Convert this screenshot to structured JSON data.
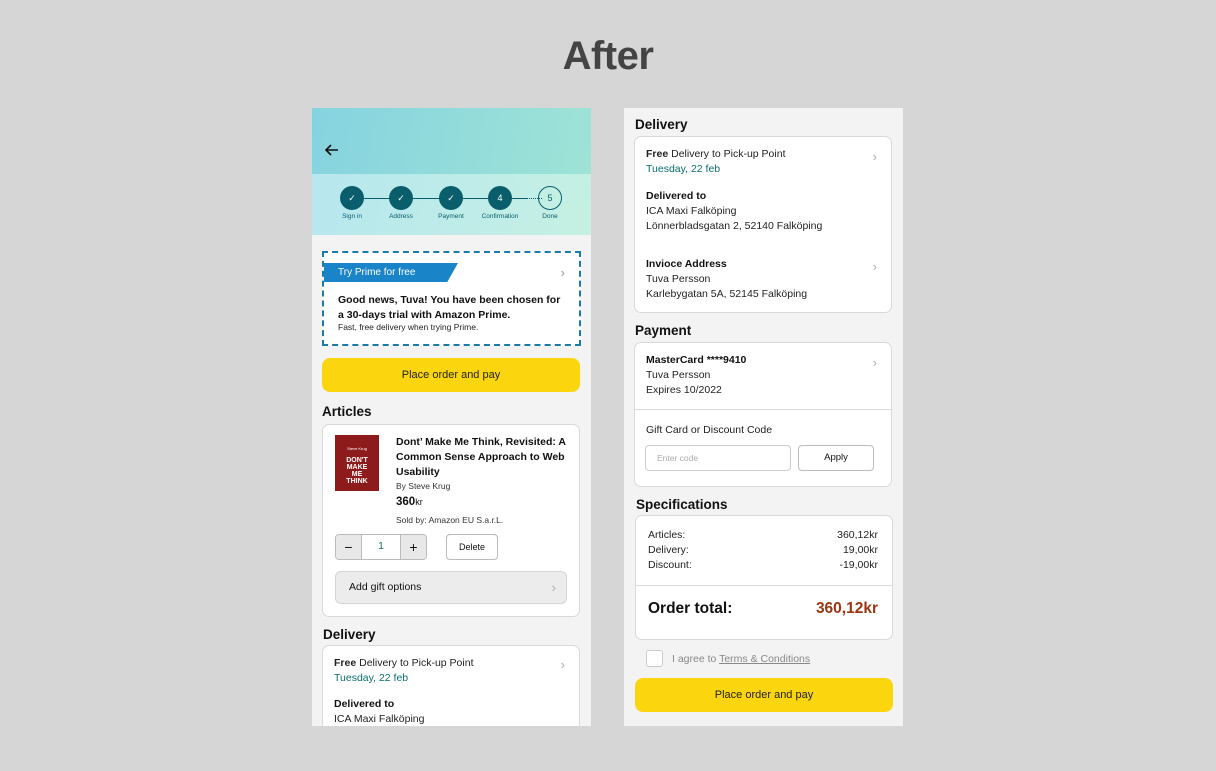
{
  "heading": "After",
  "left": {
    "steps": [
      {
        "label": "Sign in",
        "num": "✓"
      },
      {
        "label": "Address",
        "num": "✓"
      },
      {
        "label": "Payment",
        "num": "✓"
      },
      {
        "label": "Confirmation",
        "num": "4"
      },
      {
        "label": "Done",
        "num": "5"
      }
    ],
    "prime": {
      "ribbon": "Try Prime for free",
      "title": "Good news, Tuva! You have been chosen for a 30-days trial with Amazon Prime.",
      "sub": "Fast, free delivery when trying Prime."
    },
    "cta": "Place order and pay",
    "articles_title": "Articles",
    "book": {
      "cover_top": "Steve Krug",
      "cover_main": "DON'T MAKE ME THINK",
      "title": "Dont’ Make Me Think, Revisited: A Common Sense Approach to Web Usability",
      "author": "By Steve Krug",
      "price": "360",
      "currency": "kr",
      "seller": "Sold by: Amazon EU S.a.r.L."
    },
    "qty": {
      "minus": "−",
      "value": "1",
      "plus": "+"
    },
    "delete": "Delete",
    "gift": "Add gift options",
    "delivery_title": "Delivery",
    "delivery": {
      "free": "Free",
      "method": " Delivery to Pick-up Point",
      "date": "Tuesday, 22 feb",
      "to_label": "Delivered to",
      "to_name": "ICA Maxi Falköping"
    }
  },
  "right": {
    "delivery_title": "Delivery",
    "delivery": {
      "free": "Free",
      "method": " Delivery to Pick-up Point",
      "date": "Tuesday, 22 feb",
      "to_label": "Delivered to",
      "to_name": "ICA Maxi Falköping",
      "to_address": "Lönnerbladsgatan 2, 52140 Falköping",
      "invoice_label": "Invioce Address",
      "invoice_name": "Tuva Persson",
      "invoice_address": "Karlebygatan 5A, 52145 Falköping"
    },
    "payment_title": "Payment",
    "payment": {
      "card": "MasterCard ****9410",
      "name": "Tuva Persson",
      "expires": "Expires 10/2022",
      "gift_label": "Gift Card or Discount Code",
      "placeholder": "Enter code",
      "apply": "Apply"
    },
    "spec_title": "Specifications",
    "spec": [
      {
        "label": "Articles:",
        "value": "360,12kr"
      },
      {
        "label": "Delivery:",
        "value": "19,00kr"
      },
      {
        "label": "Discount:",
        "value": "-19,00kr"
      }
    ],
    "total_label": "Order total:",
    "total_value": "360,12kr",
    "terms_prefix": "I agree to ",
    "terms_link": "Terms & Conditions",
    "cta": "Place order and pay"
  }
}
